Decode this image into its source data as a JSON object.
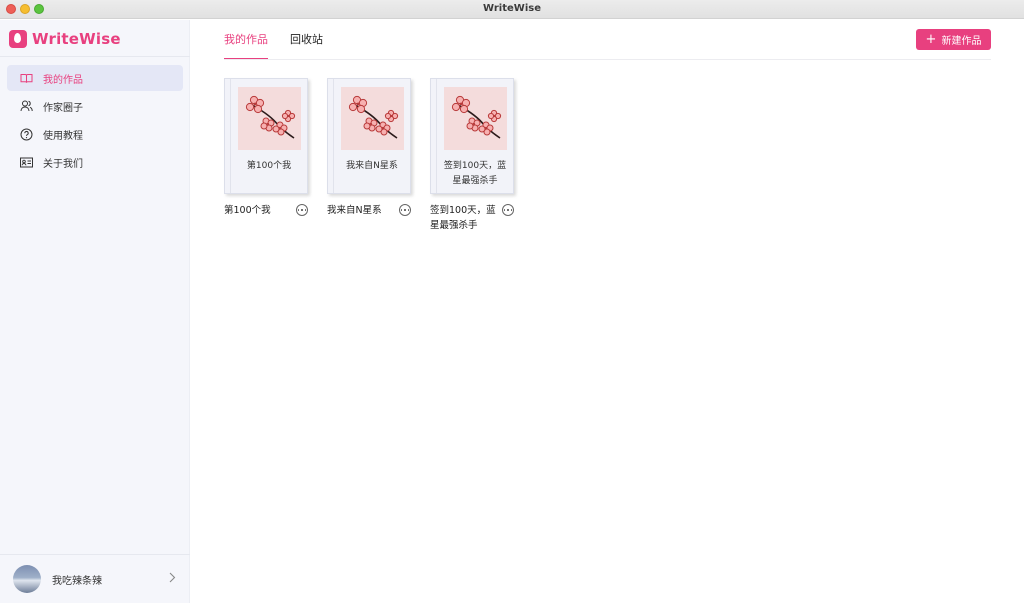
{
  "window": {
    "title": "WriteWise"
  },
  "brand": {
    "name": "WriteWise",
    "color": "#e8407f"
  },
  "sidebar": {
    "items": [
      {
        "label": "我的作品",
        "icon": "book-open-icon",
        "active": true
      },
      {
        "label": "作家圈子",
        "icon": "people-icon",
        "active": false
      },
      {
        "label": "使用教程",
        "icon": "help-circle-icon",
        "active": false
      },
      {
        "label": "关于我们",
        "icon": "id-card-icon",
        "active": false
      }
    ],
    "user": {
      "name": "我吃辣条辣"
    }
  },
  "main": {
    "tabs": [
      {
        "label": "我的作品",
        "active": true
      },
      {
        "label": "回收站",
        "active": false
      }
    ],
    "new_button": {
      "label": "新建作品",
      "icon": "plus-icon"
    },
    "works": [
      {
        "cover_title": "第100个我",
        "name": "第100个我"
      },
      {
        "cover_title": "我来自N星系",
        "name": "我来自N星系"
      },
      {
        "cover_title": "签到100天，蓝星最强杀手",
        "name": "签到100天，蓝星最强杀手"
      }
    ]
  },
  "colors": {
    "accent": "#e8407f",
    "sidebar_bg": "#f5f6fb",
    "active_item_bg": "#e4e7f6",
    "cover_bg": "#f4dcdc"
  }
}
